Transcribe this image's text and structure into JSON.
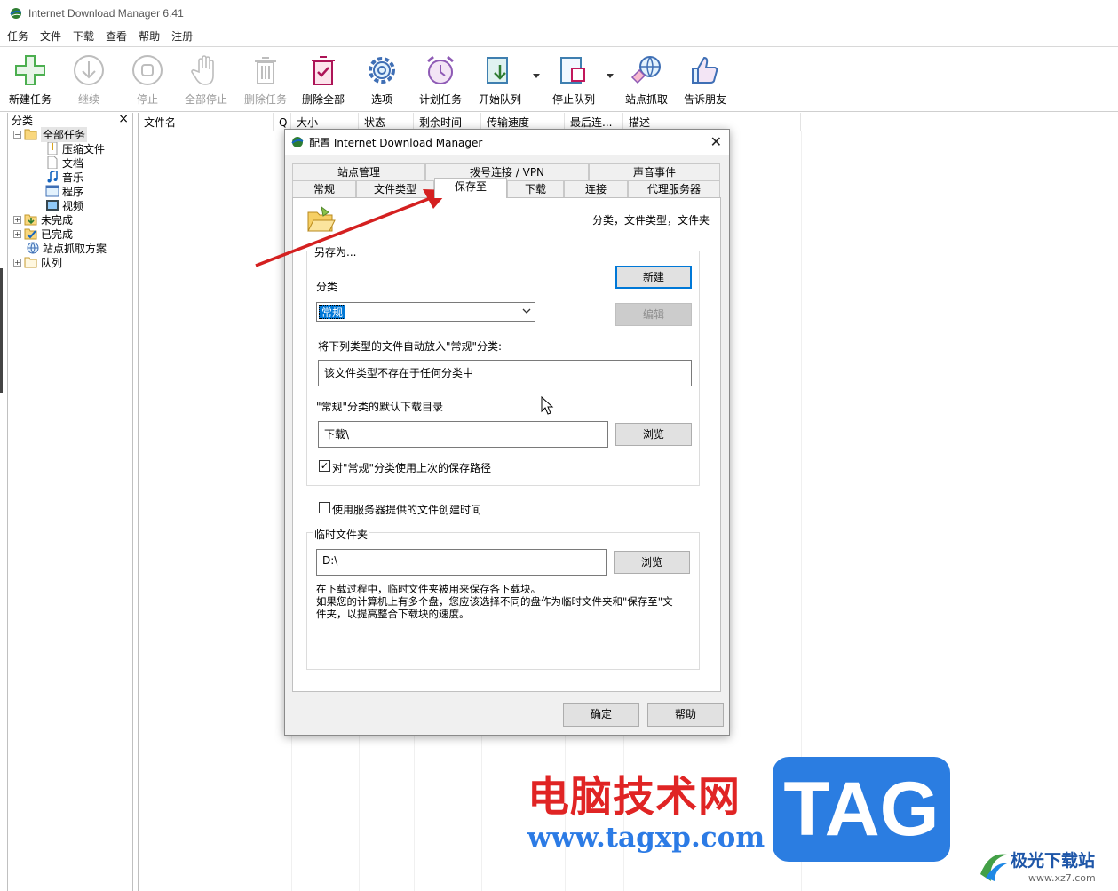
{
  "window": {
    "title": "Internet Download Manager 6.41"
  },
  "menu": [
    "任务",
    "文件",
    "下载",
    "查看",
    "帮助",
    "注册"
  ],
  "toolbar": [
    {
      "label": "新建任务",
      "icon": "plus-icon",
      "enabled": true
    },
    {
      "label": "继续",
      "icon": "download-arrow-icon",
      "enabled": false
    },
    {
      "label": "停止",
      "icon": "stop-icon",
      "enabled": false
    },
    {
      "label": "全部停止",
      "icon": "hand-stop-icon",
      "enabled": false
    },
    {
      "label": "删除任务",
      "icon": "trash-icon",
      "enabled": false
    },
    {
      "label": "删除全部",
      "icon": "trash-check-icon",
      "enabled": true
    },
    {
      "label": "选项",
      "icon": "gear-icon",
      "enabled": true
    },
    {
      "label": "计划任务",
      "icon": "alarm-clock-icon",
      "enabled": true
    },
    {
      "label": "开始队列",
      "icon": "queue-start-icon",
      "enabled": true
    },
    {
      "label": "停止队列",
      "icon": "queue-stop-icon",
      "enabled": true
    },
    {
      "label": "站点抓取",
      "icon": "site-grabber-icon",
      "enabled": true
    },
    {
      "label": "告诉朋友",
      "icon": "thumbs-up-icon",
      "enabled": true
    }
  ],
  "categories": {
    "header": "分类",
    "close": "×",
    "tree": [
      {
        "label": "全部任务",
        "expander": "−",
        "selected": true
      },
      {
        "label": "压缩文件"
      },
      {
        "label": "文档"
      },
      {
        "label": "音乐"
      },
      {
        "label": "程序"
      },
      {
        "label": "视频"
      },
      {
        "label": "未完成",
        "expander": "+"
      },
      {
        "label": "已完成",
        "expander": "+"
      },
      {
        "label": "站点抓取方案"
      },
      {
        "label": "队列",
        "expander": "+"
      }
    ]
  },
  "tasklist": {
    "columns": [
      "文件名",
      "Q",
      "大小",
      "状态",
      "剩余时间",
      "传输速度",
      "最后连...",
      "描述"
    ]
  },
  "dialog": {
    "title": "配置 Internet Download Manager",
    "close": "✕",
    "tabs_row1": [
      "站点管理",
      "拨号连接 / VPN",
      "声音事件"
    ],
    "tabs_row2": [
      "常规",
      "文件类型",
      "保存至",
      "下载",
      "连接",
      "代理服务器"
    ],
    "active_tab": "保存至",
    "header_caption": "分类，文件类型，文件夹",
    "save_as_group": "另存为...",
    "category_label": "分类",
    "category_value": "常规",
    "new_button": "新建",
    "edit_button": "编辑",
    "auto_place_label": "将下列类型的文件自动放入\"常规\"分类:",
    "file_types_value": "该文件类型不存在于任何分类中",
    "default_dir_label": "\"常规\"分类的默认下载目录",
    "default_dir_value": "下载\\",
    "browse_button": "浏览",
    "use_last_path_label": "对\"常规\"分类使用上次的保存路径",
    "use_last_path_checked": true,
    "server_time_label": "使用服务器提供的文件创建时间",
    "server_time_checked": false,
    "temp_folder_group": "临时文件夹",
    "temp_folder_value": "D:\\",
    "temp_browse_button": "浏览",
    "temp_help_1": "在下载过程中，临时文件夹被用来保存各下载块。",
    "temp_help_2": "如果您的计算机上有多个盘，您应该选择不同的盘作为临时文件夹和\"保存至\"文",
    "temp_help_3": "件夹，以提高整合下载块的速度。",
    "ok_button": "确定",
    "help_button": "帮助"
  },
  "watermark": {
    "cn_text": "电脑技术网",
    "url_text": "www.tagxp.com",
    "tag_text": "TAG",
    "site_name": "极光下载站",
    "site_url": "www.xz7.com"
  },
  "colors": {
    "accent": "#0078d7",
    "arrow": "#d42020",
    "watermark_red": "#e02424",
    "watermark_blue": "#2b7de1"
  }
}
